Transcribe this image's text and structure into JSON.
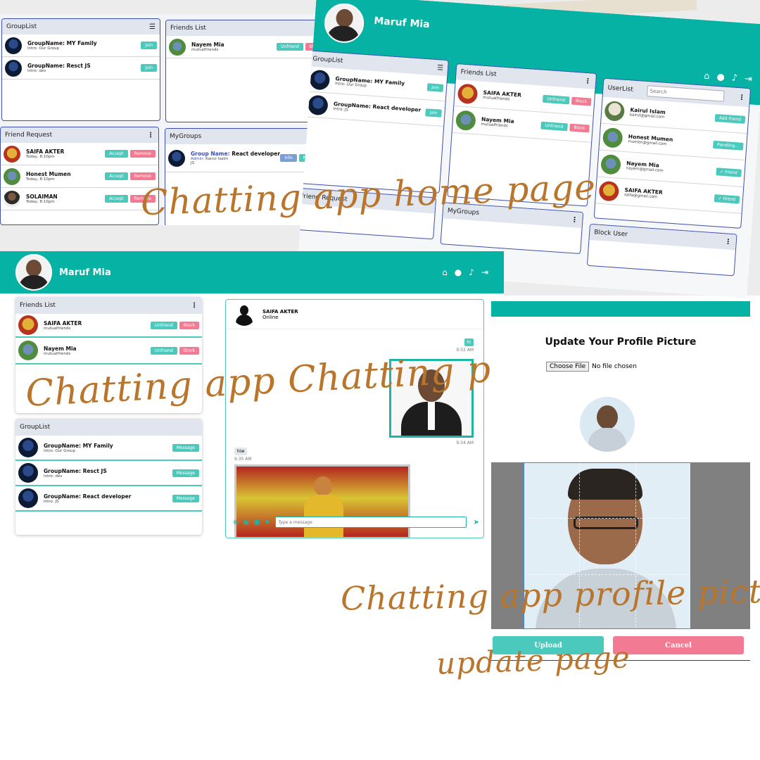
{
  "home": {
    "left": {
      "group_list": {
        "title": "GroupList",
        "rows": [
          {
            "name": "GroupName: MY Family",
            "intro": "Intro: Our Group",
            "button": "join"
          },
          {
            "name": "GroupName: Resct JS",
            "intro": "Intro: dev",
            "button": "join"
          }
        ]
      },
      "friends_list": {
        "title": "Friends List",
        "rows": [
          {
            "name": "Nayem Mia",
            "sub": "mutualfriends",
            "unfriend": "Unfriend",
            "block": "Block"
          }
        ]
      },
      "friend_request": {
        "title": "Friend Request",
        "rows": [
          {
            "name": "SAIFA AKTER",
            "time": "Today, 8:10pm",
            "accept": "Accept",
            "remove": "Remove"
          },
          {
            "name": "Honest Mumen",
            "time": "Today, 8:10pm",
            "accept": "Accept",
            "remove": "Remove"
          },
          {
            "name": "SOLAIMAN",
            "time": "Today, 8:10pm",
            "accept": "Accept",
            "remove": "Remove"
          }
        ]
      },
      "my_groups": {
        "title": "MyGroups",
        "group_label": "Group Name:",
        "group_name": "React developer",
        "admin_label": "Admin:",
        "admin_name": "Kairul Isalm",
        "intro": "JS",
        "info": "info",
        "request": "Request"
      }
    },
    "right": {
      "user_name": "Maruf Mia",
      "group_list": {
        "title": "GroupList",
        "rows": [
          {
            "name": "GroupName: MY Family",
            "intro": "Intro: Our Group",
            "button": "join"
          },
          {
            "name": "GroupName: React developer",
            "intro": "Intro: JS",
            "button": "join"
          }
        ]
      },
      "friends_list": {
        "title": "Friends List",
        "rows": [
          {
            "name": "SAIFA AKTER",
            "sub": "mutualfriends",
            "unfriend": "Unfriend",
            "block": "Block"
          },
          {
            "name": "Nayem Mia",
            "sub": "mutualfriends",
            "unfriend": "Unfriend",
            "block": "Block"
          }
        ]
      },
      "user_list": {
        "title": "UserList",
        "search_placeholder": "Search",
        "rows": [
          {
            "name": "Kairul Islam",
            "email": "kairul@gmail.com",
            "button": "Add friend"
          },
          {
            "name": "Honest Mumen",
            "email": "mumen@gmail.com",
            "button": "Pandling..."
          },
          {
            "name": "Nayem Mia",
            "email": "nayem@gmail.com",
            "button": "✓ friend"
          },
          {
            "name": "SAIFA AKTER",
            "email": "saifa@gmail.com",
            "button": "✓ friend"
          }
        ]
      },
      "friend_request_title": "Friend Request",
      "my_groups_title": "MyGroups",
      "block_user_title": "Block User"
    },
    "caption": "Chatting app home page"
  },
  "chat": {
    "user_name": "Maruf Mia",
    "friends_list": {
      "title": "Friends List",
      "rows": [
        {
          "name": "SAIFA AKTER",
          "sub": "mutualfriends",
          "unfriend": "Unfriend",
          "block": "Block"
        },
        {
          "name": "Nayem Mia",
          "sub": "mutualfriends",
          "unfriend": "Unfriend",
          "block": "Block"
        }
      ]
    },
    "group_list": {
      "title": "GroupList",
      "rows": [
        {
          "name": "GroupName: MY Family",
          "intro": "Intro: Our Group",
          "button": "Message"
        },
        {
          "name": "GroupName: Resct JS",
          "intro": "Intro: dev",
          "button": "Message"
        },
        {
          "name": "GroupName: React developer",
          "intro": "Intro: JS",
          "button": "Message"
        }
      ]
    },
    "conversation": {
      "contact_name": "SAIFA AKTER",
      "status": "Online",
      "messages": [
        {
          "text": "hi",
          "time": "9:32 AM"
        },
        {
          "image_time": "9:34 AM"
        },
        {
          "text": "hiw",
          "time": "9:35 AM"
        }
      ],
      "input_placeholder": "Type a message"
    },
    "caption": "Chatting app Chatting page"
  },
  "profile": {
    "title": "Update Your Profile Picture",
    "choose_file": "Choose File",
    "no_file": "No file chosen",
    "upload": "Upload",
    "cancel": "Cancel",
    "caption_line1": "Chatting app profile picter",
    "caption_line2": "update page"
  },
  "colors": {
    "teal": "#05b2a3",
    "accent_teal": "#4cc9bd",
    "pink": "#f27a92",
    "caption": "#b9752b"
  }
}
